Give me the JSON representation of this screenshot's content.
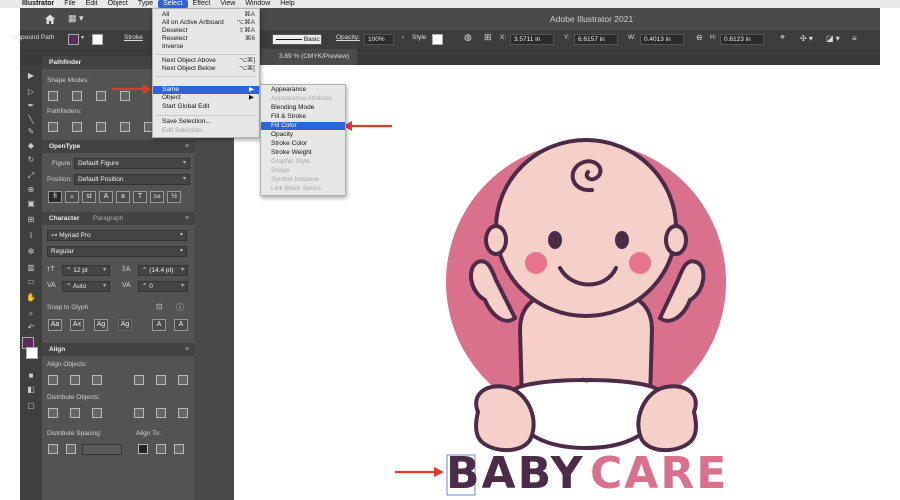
{
  "menubar": {
    "app_name": "Illustrator",
    "items": [
      "File",
      "Edit",
      "Object",
      "Type",
      "Select",
      "Effect",
      "View",
      "Window",
      "Help"
    ]
  },
  "app": {
    "title": "Adobe Illustrator 2021"
  },
  "control_bar": {
    "left_label": "ompound Path",
    "stroke_label": "Stroke",
    "brush_value": "Basic",
    "opacity_label": "Opacity:",
    "opacity_value": "100%",
    "style_label": "Style",
    "x_label": "X:",
    "x_value": "3.5711 in",
    "y_label": "Y:",
    "y_value": "6.6157 in",
    "w_label": "W:",
    "w_value": "0.4013 in",
    "h_label": "H:",
    "h_value": "0.6123 in"
  },
  "document_tab": {
    "label": "3.89 % (CMYK/Preview)"
  },
  "select_menu": {
    "items": [
      {
        "label": "All",
        "shortcut": "⌘A"
      },
      {
        "label": "All on Active Artboard",
        "shortcut": "⌥⌘A"
      },
      {
        "label": "Deselect",
        "shortcut": "⇧⌘A"
      },
      {
        "label": "Reselect",
        "shortcut": "⌘6"
      },
      {
        "label": "Inverse",
        "shortcut": ""
      },
      {
        "label": "Next Object Above",
        "shortcut": "⌥⌘]"
      },
      {
        "label": "Next Object Below",
        "shortcut": "⌥⌘["
      },
      {
        "label": "Same",
        "shortcut": "▶"
      },
      {
        "label": "Object",
        "shortcut": "▶"
      },
      {
        "label": "Start Global Edit",
        "shortcut": ""
      },
      {
        "label": "Save Selection...",
        "shortcut": ""
      },
      {
        "label": "Edit Selection...",
        "shortcut": ""
      }
    ]
  },
  "same_submenu": {
    "items": [
      "Appearance",
      "Appearance Attribute",
      "Blending Mode",
      "Fill & Stroke",
      "Fill Color",
      "Opacity",
      "Stroke Color",
      "Stroke Weight",
      "Graphic Style",
      "Shape",
      "Symbol Instance",
      "Link Block Series"
    ]
  },
  "pathfinder_panel": {
    "title": "Pathfinder",
    "shape_modes_label": "Shape Modes:",
    "pathfinders_label": "Pathfinders:"
  },
  "opentype_panel": {
    "title": "OpenType",
    "figure_label": "Figure:",
    "figure_value": "Default Figure",
    "position_label": "Position:",
    "position_value": "Default Position",
    "glyphs": [
      "fi",
      "ℴ",
      "st",
      "A",
      "a",
      "T",
      "1st",
      "½"
    ]
  },
  "character_panel": {
    "title": "Character",
    "tab2": "Paragraph",
    "font_value": "Myriad Pro",
    "style_value": "Regular",
    "size_value": "12 pt",
    "leading_value": "(14.4 pt)",
    "kerning_value": "Auto",
    "tracking_value": "0",
    "snap_label": "Snap to Glyph"
  },
  "align_panel": {
    "title": "Align",
    "align_objects_label": "Align Objects:",
    "distribute_objects_label": "Distribute Objects:",
    "distribute_spacing_label": "Distribute Spacing:",
    "align_to_label": "Align To:"
  },
  "artwork": {
    "word1": "BABY",
    "word2": "CARE",
    "colors": {
      "circle": "#d9708c",
      "skin": "#f6cfc8",
      "outline": "#4b2b47",
      "cheek": "#e8748a",
      "word1": "#4b2b47",
      "word2": "#d9708c",
      "arrow": "#e03a2a",
      "menu_highlight": "#2b66d9"
    }
  }
}
